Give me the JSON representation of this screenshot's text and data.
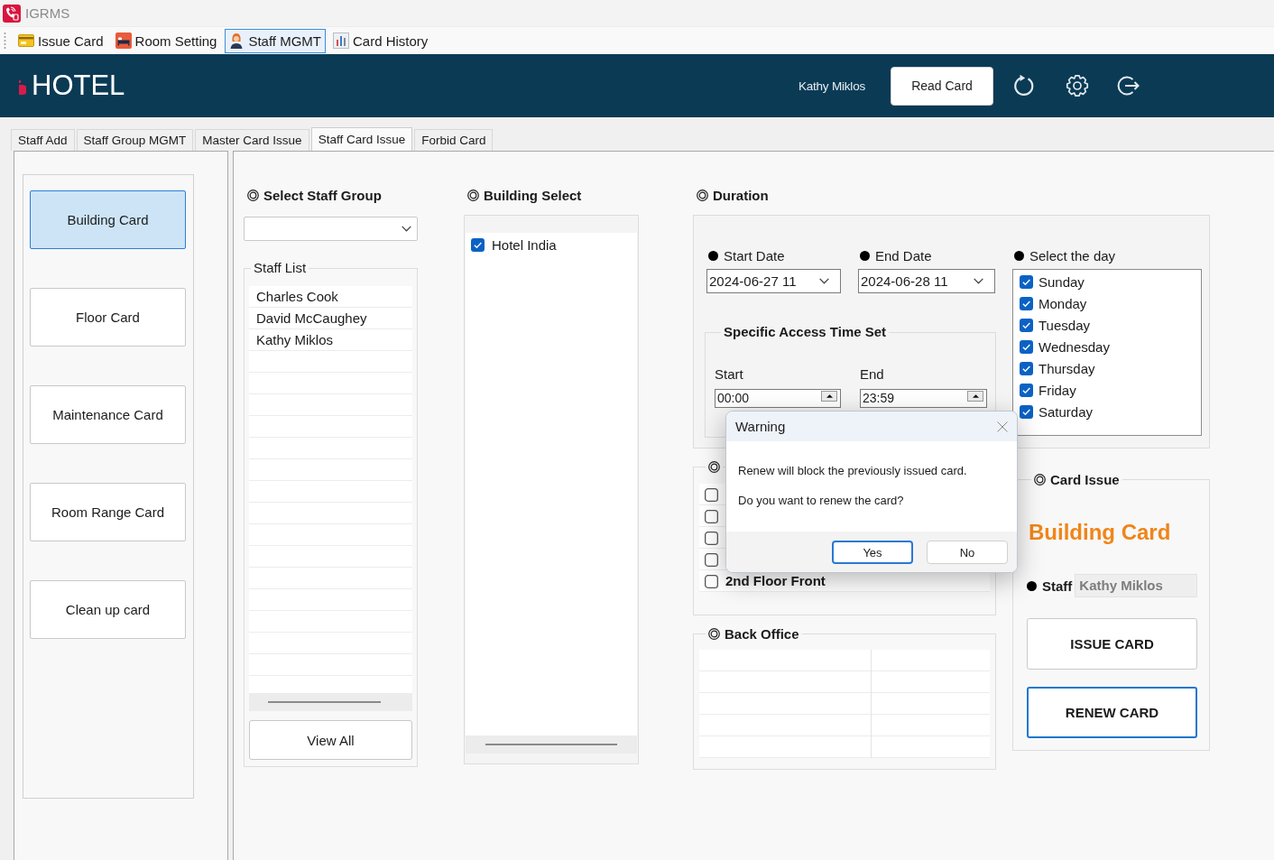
{
  "app": {
    "title": "IGRMS"
  },
  "toolbar": [
    {
      "label": "Issue Card",
      "kind": "card",
      "selected": false
    },
    {
      "label": "Room Setting",
      "kind": "bed",
      "selected": false
    },
    {
      "label": "Staff MGMT",
      "kind": "person",
      "selected": true
    },
    {
      "label": "Card History",
      "kind": "chart",
      "selected": false
    }
  ],
  "header": {
    "brand": "HOTEL",
    "user": "Kathy Miklos",
    "read_card_button": "Read Card"
  },
  "tabs": [
    {
      "label": "Staff Add",
      "selected": false
    },
    {
      "label": "Staff Group MGMT",
      "selected": false
    },
    {
      "label": "Master Card Issue",
      "selected": false
    },
    {
      "label": "Staff Card Issue",
      "selected": true
    },
    {
      "label": "Forbid Card",
      "selected": false
    }
  ],
  "card_types": [
    {
      "label": "Building Card",
      "selected": true
    },
    {
      "label": "Floor Card",
      "selected": false
    },
    {
      "label": "Maintenance Card",
      "selected": false
    },
    {
      "label": "Room Range Card",
      "selected": false
    },
    {
      "label": "Clean up card",
      "selected": false
    }
  ],
  "staff_group": {
    "title": "Select Staff Group"
  },
  "staff_list": {
    "title": "Staff List",
    "items": [
      "Charles Cook",
      "David McCaughey",
      "Kathy Miklos"
    ],
    "button": "View All"
  },
  "building_select": {
    "title": "Building Select",
    "items": [
      {
        "label": "Hotel India",
        "checked": true
      }
    ]
  },
  "duration": {
    "title": "Duration",
    "start_date": {
      "label": "Start Date",
      "value": "2024-06-27 11"
    },
    "end_date": {
      "label": "End Date",
      "value": "2024-06-28 11"
    },
    "access_time": {
      "title": "Specific Access Time Set",
      "start": {
        "label": "Start",
        "value": "00:00"
      },
      "end": {
        "label": "End",
        "value": "23:59"
      }
    },
    "days": {
      "label": "Select the day",
      "items": [
        {
          "label": "Sunday",
          "checked": true
        },
        {
          "label": "Monday",
          "checked": true
        },
        {
          "label": "Tuesday",
          "checked": true
        },
        {
          "label": "Wednesday",
          "checked": true
        },
        {
          "label": "Thursday",
          "checked": true
        },
        {
          "label": "Friday",
          "checked": true
        },
        {
          "label": "Saturday",
          "checked": true
        }
      ]
    }
  },
  "floors": {
    "items": [
      {
        "checked": false
      },
      {
        "checked": false
      },
      {
        "checked": false
      },
      {
        "checked": false
      },
      {
        "label": "2nd Floor Front",
        "checked": false
      }
    ]
  },
  "back_office": {
    "title": "Back Office"
  },
  "card_issue": {
    "title": "Card Issue",
    "card_type": "Building Card",
    "staff_label": "Staff",
    "staff_value": "Kathy Miklos",
    "buttons": [
      {
        "label": "ISSUE CARD",
        "focused": false
      },
      {
        "label": "RENEW CARD",
        "focused": true
      }
    ]
  },
  "dialog": {
    "title": "Warning",
    "messages": [
      "Renew will block the previously issued card.",
      "Do you want to renew the card?"
    ],
    "buttons": [
      {
        "label": "Yes",
        "focused": true
      },
      {
        "label": "No",
        "focused": false
      }
    ]
  }
}
